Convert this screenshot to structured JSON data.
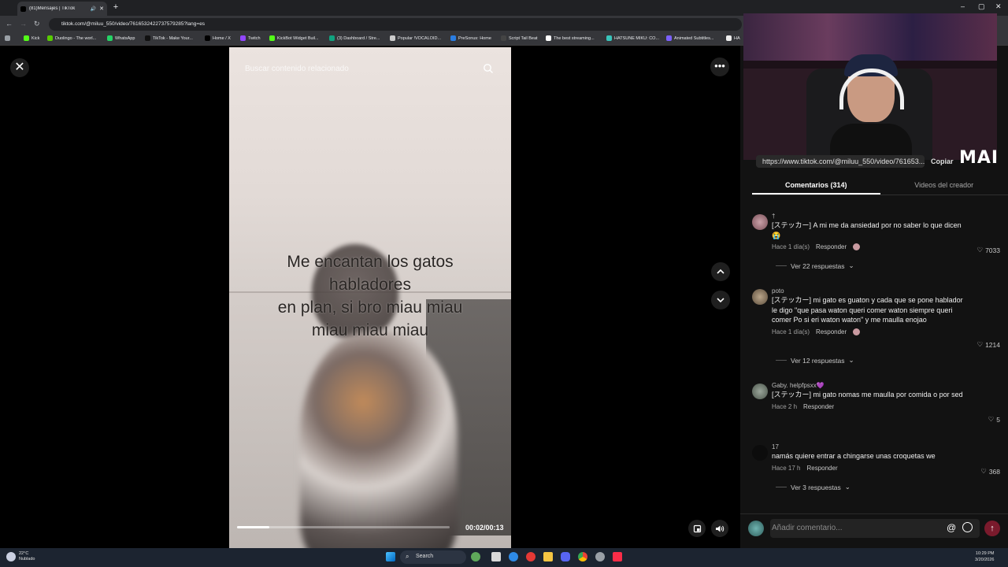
{
  "browser": {
    "tab_title": "(81)Mensajes | TikTok",
    "url": "tiktok.com/@miluu_550/video/7616532422737579285?lang=es",
    "bookmarks": [
      "Kick",
      "Duolingo - The worl...",
      "WhatsApp",
      "TikTok - Make Your...",
      "Home / X",
      "Twitch",
      "KickBot Widget Buil...",
      "(3) Dashboard / Stre...",
      "Popular !VOCALOID...",
      "PreSonus: Home",
      "Script Tail Beat",
      "The best streaming...",
      "HATSUNE MIKU: CO...",
      "Animated Subtitles...",
      "HA"
    ]
  },
  "player": {
    "search_placeholder": "Buscar contenido relacionado",
    "caption_lines": [
      "Me encantan los gatos",
      "habladores",
      "en plan, si bro miau miau",
      "miau miau miau"
    ],
    "time": "00:02/00:13",
    "progress": 0.15
  },
  "stream_overlay": {
    "watermark": "MAI"
  },
  "share": {
    "link": "https://www.tiktok.com/@miluu_550/video/761653...",
    "copy_label": "Copiar"
  },
  "tabs": {
    "comments": "Comentarios (314)",
    "creator_videos": "Videos del creador"
  },
  "comments": [
    {
      "user": "†",
      "text": "[ステッカー] A mi me da ansiedad por no saber lo que dicen 😭",
      "time": "Hace 1 día(s)",
      "reply": "Responder",
      "likes": "7033",
      "replies": "Ver 22 respuestas"
    },
    {
      "user": "poto",
      "text": "[ステッカー] mi gato es guaton y cada que se pone hablador le digo \"que pasa waton queri comer waton siempre queri comer Po si eri waton waton\" y me maulla enojao",
      "time": "Hace 1 día(s)",
      "reply": "Responder",
      "likes": "1214",
      "replies": "Ver 12 respuestas"
    },
    {
      "user": "Gaby. helpfpsxx💜",
      "text": "[ステッカー] mi gato nomas me maulla por comida o por sed",
      "time": "Hace 2 h",
      "reply": "Responder",
      "likes": "5",
      "replies": ""
    },
    {
      "user": "17",
      "text": "namás quiere entrar a chingarse unas croquetas we",
      "time": "Hace 17 h",
      "reply": "Responder",
      "likes": "368",
      "replies": "Ver 3 respuestas"
    }
  ],
  "add_comment": {
    "placeholder": "Añadir comentario..."
  },
  "taskbar": {
    "temp": "22°C",
    "weather": "Nublado",
    "search": "Search",
    "time": "10:29 PM",
    "date": "3/20/2026"
  },
  "colors": {
    "accent": "#fe2c55",
    "send_disabled": "#7a1a2c",
    "panel_bg": "#121212"
  }
}
